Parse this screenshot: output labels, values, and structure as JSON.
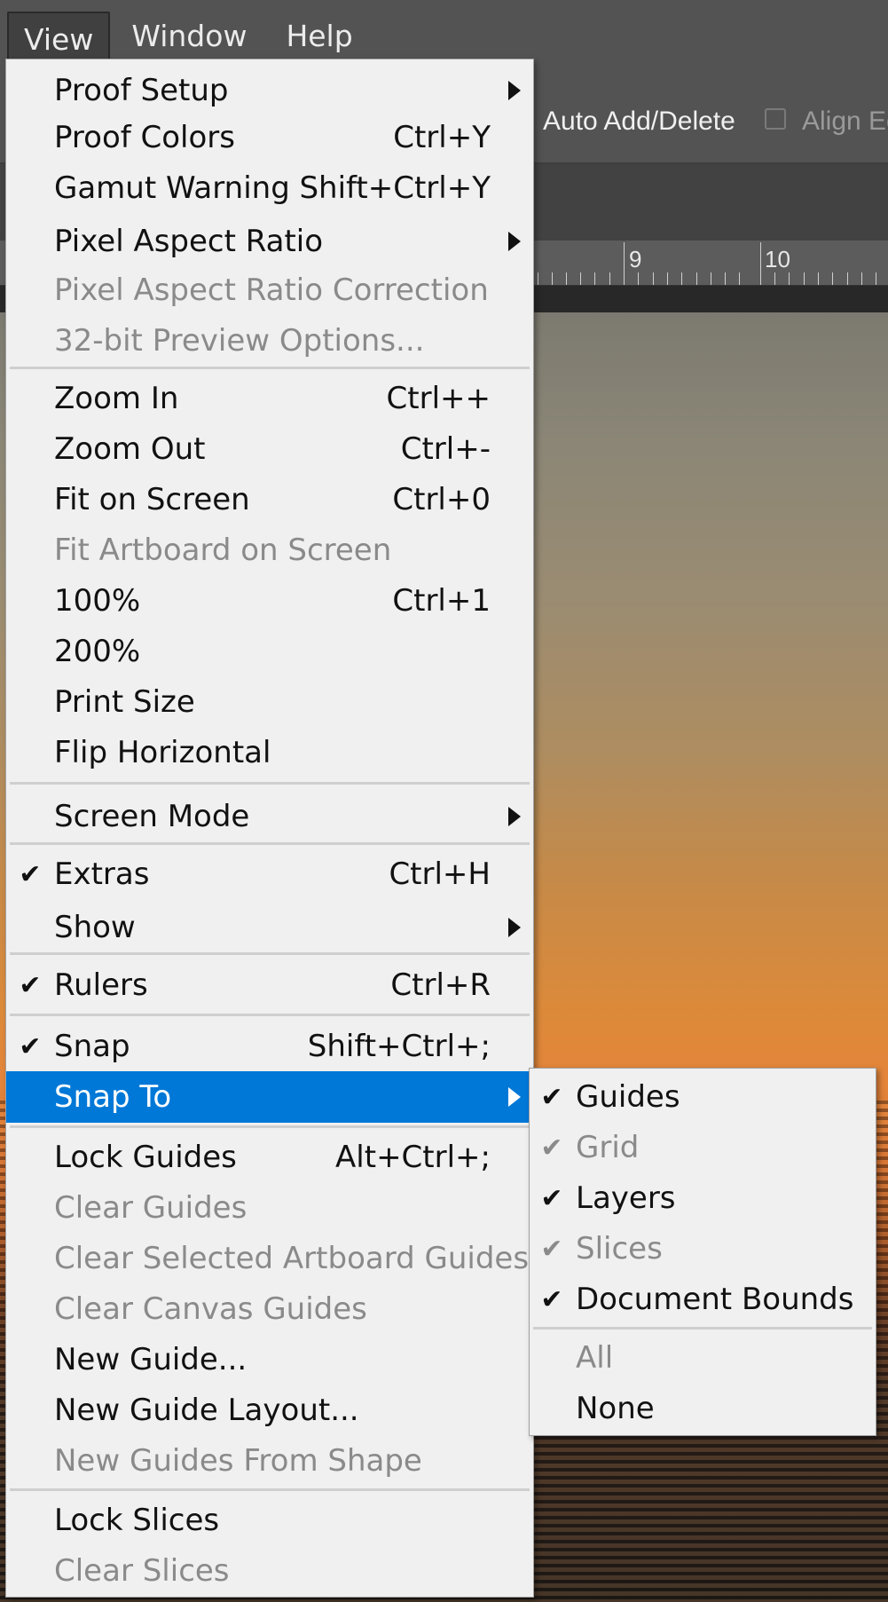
{
  "menubar": {
    "items": [
      "View",
      "Window",
      "Help"
    ],
    "active": "View"
  },
  "options_bar": {
    "auto_add_delete": "Auto Add/Delete",
    "align_edges": "Align Ec"
  },
  "ruler": {
    "labels": [
      "9",
      "10"
    ]
  },
  "view_menu": {
    "items": {
      "proof_setup": {
        "label": "Proof Setup"
      },
      "proof_colors": {
        "label": "Proof Colors",
        "shortcut": "Ctrl+Y"
      },
      "gamut_warning": {
        "label": "Gamut Warning",
        "shortcut": "Shift+Ctrl+Y"
      },
      "pixel_aspect_ratio": {
        "label": "Pixel Aspect Ratio"
      },
      "pixel_aspect_ratio_correction": {
        "label": "Pixel Aspect Ratio Correction"
      },
      "preview_options_32bit": {
        "label": "32-bit Preview Options..."
      },
      "zoom_in": {
        "label": "Zoom In",
        "shortcut": "Ctrl++"
      },
      "zoom_out": {
        "label": "Zoom Out",
        "shortcut": "Ctrl+-"
      },
      "fit_on_screen": {
        "label": "Fit on Screen",
        "shortcut": "Ctrl+0"
      },
      "fit_artboard": {
        "label": "Fit Artboard on Screen"
      },
      "zoom_100": {
        "label": "100%",
        "shortcut": "Ctrl+1"
      },
      "zoom_200": {
        "label": "200%"
      },
      "print_size": {
        "label": "Print Size"
      },
      "flip_horizontal": {
        "label": "Flip Horizontal"
      },
      "screen_mode": {
        "label": "Screen Mode"
      },
      "extras": {
        "label": "Extras",
        "shortcut": "Ctrl+H",
        "checked": true
      },
      "show": {
        "label": "Show"
      },
      "rulers": {
        "label": "Rulers",
        "shortcut": "Ctrl+R",
        "checked": true
      },
      "snap": {
        "label": "Snap",
        "shortcut": "Shift+Ctrl+;",
        "checked": true
      },
      "snap_to": {
        "label": "Snap To"
      },
      "lock_guides": {
        "label": "Lock Guides",
        "shortcut": "Alt+Ctrl+;"
      },
      "clear_guides": {
        "label": "Clear Guides"
      },
      "clear_selected_artboard_guides": {
        "label": "Clear Selected Artboard Guides"
      },
      "clear_canvas_guides": {
        "label": "Clear Canvas Guides"
      },
      "new_guide": {
        "label": "New Guide..."
      },
      "new_guide_layout": {
        "label": "New Guide Layout..."
      },
      "new_guides_from_shape": {
        "label": "New Guides From Shape"
      },
      "lock_slices": {
        "label": "Lock Slices"
      },
      "clear_slices": {
        "label": "Clear Slices"
      }
    },
    "check_glyph": "✔"
  },
  "snap_to_submenu": {
    "items": {
      "guides": {
        "label": "Guides",
        "checked": true
      },
      "grid": {
        "label": "Grid",
        "checked": true
      },
      "layers": {
        "label": "Layers",
        "checked": true
      },
      "slices": {
        "label": "Slices",
        "checked": true
      },
      "document_bounds": {
        "label": "Document Bounds",
        "checked": true
      },
      "all": {
        "label": "All"
      },
      "none": {
        "label": "None"
      }
    },
    "check_glyph": "✔"
  },
  "colors": {
    "highlight": "#0078d7",
    "menu_bg": "#f0f0f0",
    "disabled_text": "#8a8a8a",
    "app_chrome": "#535353"
  }
}
